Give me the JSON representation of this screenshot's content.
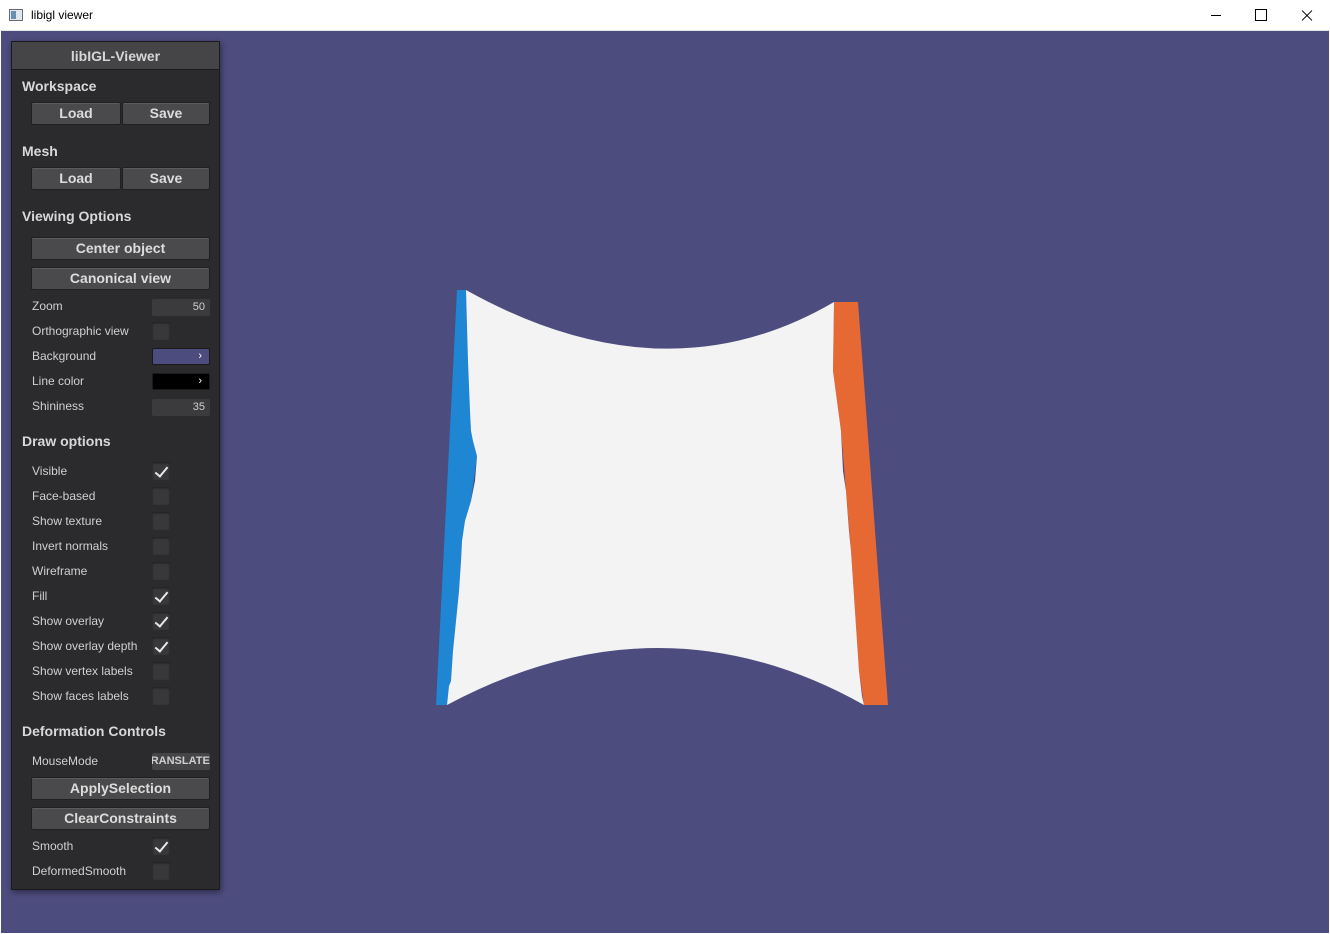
{
  "window": {
    "title": "libigl viewer"
  },
  "panel": {
    "title": "libIGL-Viewer",
    "workspace": {
      "header": "Workspace",
      "load_label": "Load",
      "save_label": "Save"
    },
    "mesh": {
      "header": "Mesh",
      "load_label": "Load",
      "save_label": "Save"
    },
    "viewing": {
      "header": "Viewing Options",
      "center_label": "Center object",
      "canonical_label": "Canonical view",
      "zoom_label": "Zoom",
      "zoom_value": "50",
      "ortho_label": "Orthographic view",
      "ortho_checked": false,
      "background_label": "Background",
      "background_color": "#4d4c7e",
      "line_color_label": "Line color",
      "line_color": "#000000",
      "shininess_label": "Shininess",
      "shininess_value": "35"
    },
    "draw": {
      "header": "Draw options",
      "items": [
        {
          "label": "Visible",
          "checked": true
        },
        {
          "label": "Face-based",
          "checked": false
        },
        {
          "label": "Show texture",
          "checked": false
        },
        {
          "label": "Invert normals",
          "checked": false
        },
        {
          "label": "Wireframe",
          "checked": false
        },
        {
          "label": "Fill",
          "checked": true
        },
        {
          "label": "Show overlay",
          "checked": true
        },
        {
          "label": "Show overlay depth",
          "checked": true
        },
        {
          "label": "Show vertex labels",
          "checked": false
        },
        {
          "label": "Show faces labels",
          "checked": false
        }
      ]
    },
    "deformation": {
      "header": "Deformation Controls",
      "mousemode_label": "MouseMode",
      "mousemode_value": "TRANSLATE",
      "apply_label": "ApplySelection",
      "clear_label": "ClearConstraints",
      "smooth_label": "Smooth",
      "smooth_checked": true,
      "deformed_smooth_label": "DeformedSmooth",
      "deformed_smooth_checked": false
    }
  },
  "scene": {
    "background": "#4d4c7e",
    "mesh_color": "#f3f3f3",
    "left_handle_color": "#1e86d3",
    "right_handle_color": "#e66833"
  }
}
